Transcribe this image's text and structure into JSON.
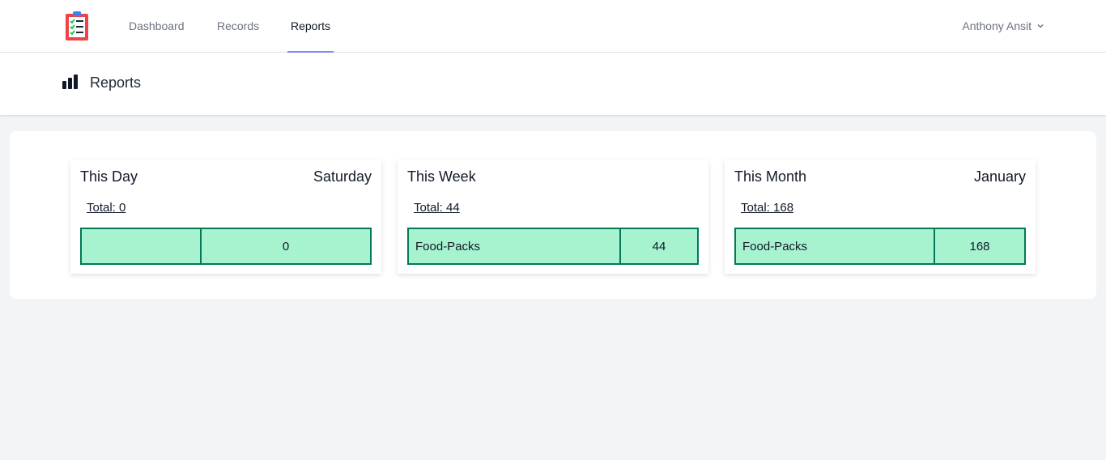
{
  "nav": {
    "logo_icon": "clipboard-checklist-icon",
    "links": [
      "Dashboard",
      "Records",
      "Reports"
    ],
    "active": "Reports",
    "user_name": "Anthony Ansit",
    "user_menu_icon": "chevron-down-icon"
  },
  "header": {
    "icon": "bar-chart-icon",
    "title": "Reports"
  },
  "cards": [
    {
      "title": "This Day",
      "subtitle": "Saturday",
      "total": "Total: 0",
      "rows": [
        {
          "label": "",
          "value": "0"
        }
      ]
    },
    {
      "title": "This Week",
      "subtitle": "",
      "total": "Total: 44",
      "rows": [
        {
          "label": "Food-Packs",
          "value": "44"
        }
      ]
    },
    {
      "title": "This Month",
      "subtitle": "January",
      "total": "Total: 168",
      "rows": [
        {
          "label": "Food-Packs",
          "value": "168"
        }
      ]
    }
  ],
  "colors": {
    "accent_underline": "#818cf8",
    "table_fill": "#a7f3d0",
    "table_border": "#047857",
    "logo_red": "#ef4444",
    "logo_clip_blue": "#3b82f6"
  }
}
